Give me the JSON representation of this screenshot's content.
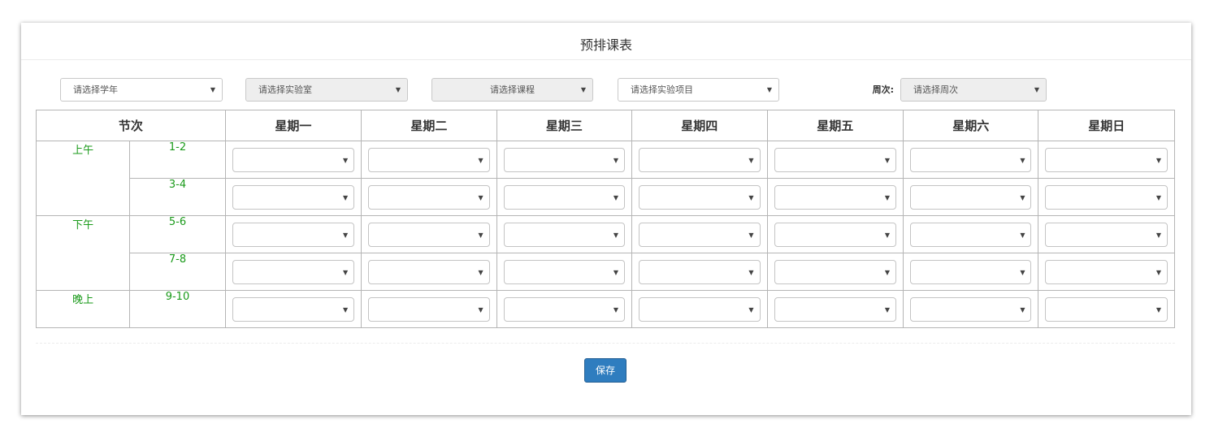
{
  "page": {
    "title": "预排课表"
  },
  "filters": {
    "year": {
      "placeholder": "请选择学年"
    },
    "lab": {
      "placeholder": "请选择实验室"
    },
    "course": {
      "placeholder": "请选择课程"
    },
    "project": {
      "placeholder": "请选择实验项目"
    },
    "week_label": "周次:",
    "week": {
      "placeholder": "请选择周次"
    }
  },
  "schedule": {
    "section_header": "节次",
    "days": [
      "星期一",
      "星期二",
      "星期三",
      "星期四",
      "星期五",
      "星期六",
      "星期日"
    ],
    "periods": [
      {
        "label": "上午",
        "slots": [
          "1-2",
          "3-4"
        ]
      },
      {
        "label": "下午",
        "slots": [
          "5-6",
          "7-8"
        ]
      },
      {
        "label": "晚上",
        "slots": [
          "9-10"
        ]
      }
    ]
  },
  "actions": {
    "save_label": "保存"
  },
  "colors": {
    "period_text": "#1a9a1a",
    "primary_button": "#2f7dbf"
  },
  "icons": {
    "dropdown": "chevron-down-icon"
  }
}
